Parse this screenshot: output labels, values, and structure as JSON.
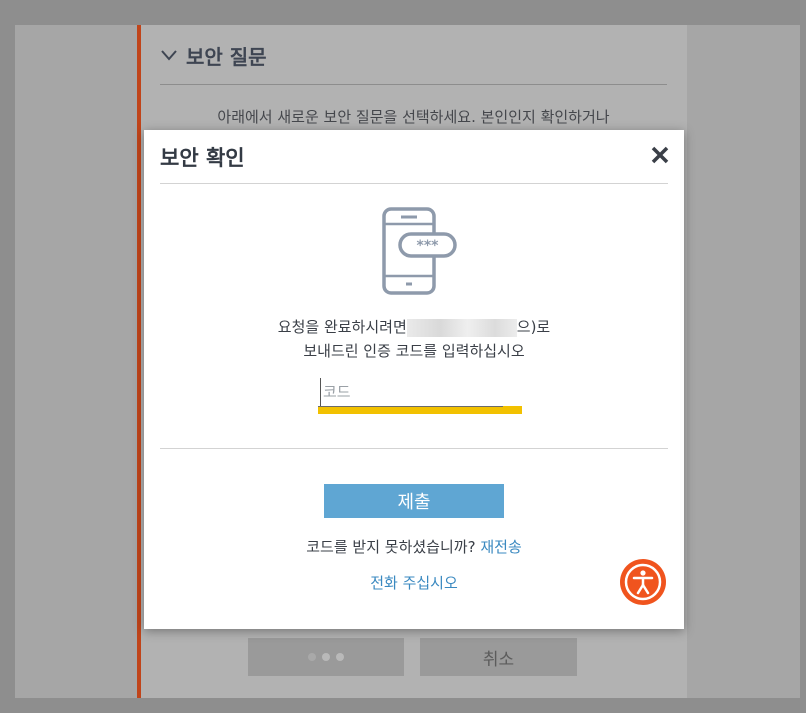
{
  "background": {
    "section_title": "보안 질문",
    "description": "아래에서 새로운 보안 질문을 선택하세요. 본인인지 확인하거나",
    "cancel_label": "취소"
  },
  "modal": {
    "title": "보안 확인",
    "message_prefix": "요청을 완료하시려면",
    "message_suffix": "으)로",
    "message_line2": "보내드린 인증 코드를 입력하십시오",
    "code_placeholder": "코드",
    "code_value": "",
    "submit_label": "제출",
    "resend_prompt": "코드를 받지 못하셨습니까?",
    "resend_link": "재전송",
    "call_link": "전화 주십시오"
  },
  "colors": {
    "accent": "#c0441a",
    "primary_button": "#5fa6d3",
    "link": "#3a89c0",
    "input_highlight": "#f2c100",
    "accessibility_button": "#f0541e"
  }
}
